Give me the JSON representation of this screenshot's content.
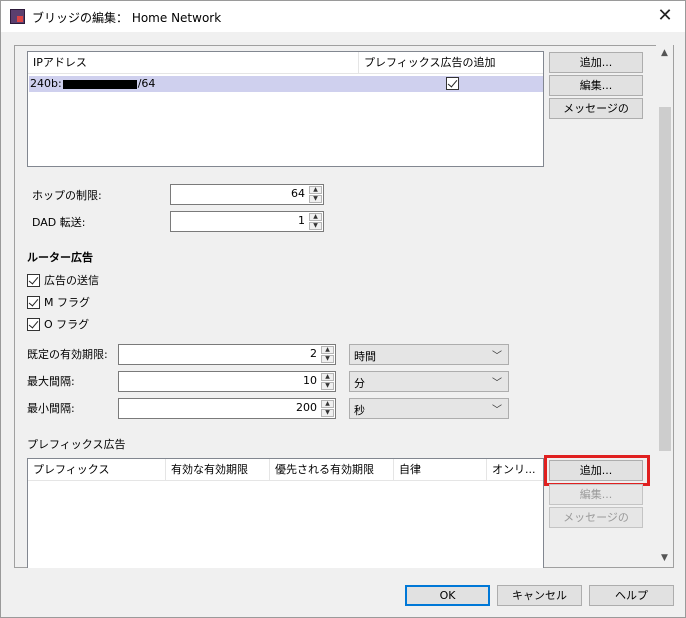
{
  "window": {
    "title": "ブリッジの編集： Home Network",
    "close_glyph": "✕"
  },
  "address_table": {
    "columns": [
      "IPアドレス",
      "プレフィックス広告の追加"
    ],
    "rows": [
      {
        "ip_prefix": "240b:",
        "ip_suffix": "/64",
        "prefix_ad": true
      }
    ],
    "buttons": {
      "add": "追加...",
      "edit": "編集...",
      "message": "メッセージの"
    }
  },
  "fields": {
    "hop_limit": {
      "label": "ホップの制限:",
      "value": "64"
    },
    "dad": {
      "label": "DAD 転送:",
      "value": "1"
    }
  },
  "router_ad": {
    "heading": "ルーター広告",
    "checkboxes": [
      {
        "label": "広告の送信",
        "checked": true
      },
      {
        "label": "M フラグ",
        "checked": true
      },
      {
        "label": "O フラグ",
        "checked": true
      }
    ],
    "default_lifetime": {
      "label": "既定の有効期限:",
      "value": "2",
      "unit": "時間"
    },
    "max_interval": {
      "label": "最大間隔:",
      "value": "10",
      "unit": "分"
    },
    "min_interval": {
      "label": "最小間隔:",
      "value": "200",
      "unit": "秒"
    }
  },
  "prefix_ad": {
    "heading": "プレフィックス広告",
    "columns": [
      "プレフィックス",
      "有効な有効期限",
      "優先される有効期限",
      "自律",
      "オンリ..."
    ],
    "buttons": {
      "add": "追加...",
      "edit": "編集...",
      "message": "メッセージの"
    }
  },
  "footer": {
    "ok": "OK",
    "cancel": "キャンセル",
    "help": "ヘルプ"
  },
  "colors": {
    "highlight": "#e02020",
    "selection": "#cfd0ee"
  }
}
